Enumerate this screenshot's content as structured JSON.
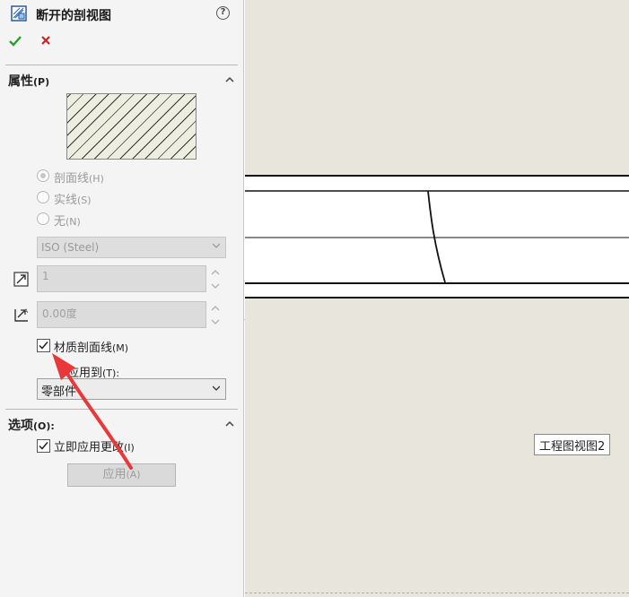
{
  "panel": {
    "title": "断开的剖视图",
    "help_icon": "question-mark-icon",
    "ok_icon": "checkmark-icon",
    "cancel_icon": "x-icon",
    "properties": {
      "title": "属性",
      "key": "(P)",
      "hatch_pattern": "ANSI31 diagonal hatch",
      "radios": [
        {
          "label": "剖面线",
          "key": "(H)",
          "selected": true
        },
        {
          "label": "实线",
          "key": "(S)",
          "selected": false
        },
        {
          "label": "无",
          "key": "(N)",
          "selected": false
        }
      ],
      "pattern_select": "ISO (Steel)",
      "scale_value": "1",
      "angle_value": "0.00度",
      "material_hatch": {
        "label": "材质剖面线",
        "key": "(M)",
        "checked": true
      },
      "apply_to": {
        "label": "应用到",
        "key": "(T):",
        "value": "零部件"
      }
    },
    "options": {
      "title": "选项",
      "key": "(O):",
      "auto_update": {
        "label": "立即应用更改",
        "key": "(I)",
        "checked": true
      },
      "apply_button": {
        "label": "应用",
        "key": "(A)"
      }
    }
  },
  "canvas": {
    "view_label": "工程图视图2",
    "background": "#e8e6dc"
  },
  "annotation": {
    "arrow_color": "#e8383a"
  }
}
